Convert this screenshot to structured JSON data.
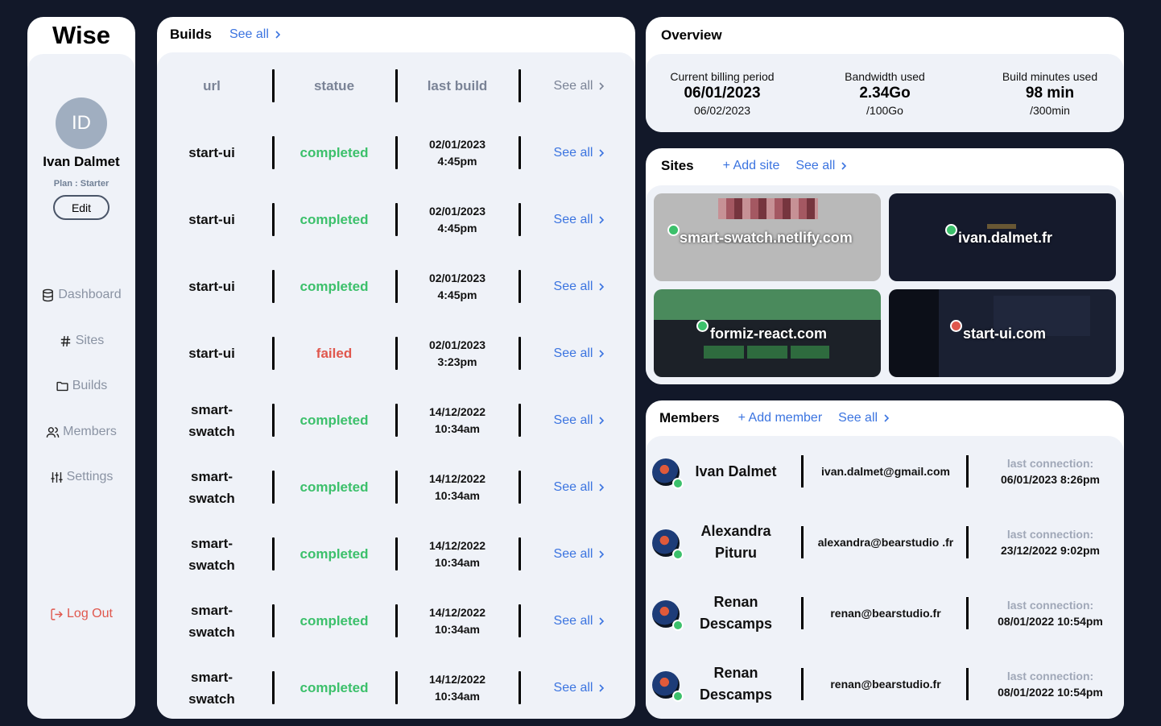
{
  "sidebar": {
    "logo": "Wise",
    "avatar_initials": "ID",
    "user_name": "Ivan Dalmet",
    "plan": "Plan : Starter",
    "edit_label": "Edit",
    "nav": [
      {
        "label": "Dashboard",
        "icon": "database-icon"
      },
      {
        "label": "Sites",
        "icon": "hash-icon"
      },
      {
        "label": "Builds",
        "icon": "folder-icon"
      },
      {
        "label": "Members",
        "icon": "users-icon"
      },
      {
        "label": "Settings",
        "icon": "sliders-icon"
      }
    ],
    "logout_label": "Log Out"
  },
  "builds": {
    "title": "Builds",
    "see_all": "See all",
    "headers": {
      "url": "url",
      "status": "statue",
      "last_build": "last build",
      "see_all": "See all"
    },
    "rows": [
      {
        "url": "start-ui",
        "status": "completed",
        "date": "02/01/2023",
        "time": "4:45pm",
        "see_all": "See all"
      },
      {
        "url": "start-ui",
        "status": "completed",
        "date": "02/01/2023",
        "time": "4:45pm",
        "see_all": "See all"
      },
      {
        "url": "start-ui",
        "status": "completed",
        "date": "02/01/2023",
        "time": "4:45pm",
        "see_all": "See all"
      },
      {
        "url": "start-ui",
        "status": "failed",
        "date": "02/01/2023",
        "time": "3:23pm",
        "see_all": "See all"
      },
      {
        "url": "smart-swatch",
        "status": "completed",
        "date": "14/12/2022",
        "time": "10:34am",
        "see_all": "See all"
      },
      {
        "url": "smart-swatch",
        "status": "completed",
        "date": "14/12/2022",
        "time": "10:34am",
        "see_all": "See all"
      },
      {
        "url": "smart-swatch",
        "status": "completed",
        "date": "14/12/2022",
        "time": "10:34am",
        "see_all": "See all"
      },
      {
        "url": "smart-swatch",
        "status": "completed",
        "date": "14/12/2022",
        "time": "10:34am",
        "see_all": "See all"
      },
      {
        "url": "smart-swatch",
        "status": "completed",
        "date": "14/12/2022",
        "time": "10:34am",
        "see_all": "See all"
      }
    ]
  },
  "overview": {
    "title": "Overview",
    "billing": {
      "label": "Current billing period",
      "value": "06/01/2023",
      "sub": "06/02/2023"
    },
    "bandwidth": {
      "label": "Bandwidth used",
      "value": "2.34Go",
      "sub": "/100Go"
    },
    "build_minutes": {
      "label": "Build minutes used",
      "value": "98 min",
      "sub": "/300min"
    }
  },
  "sites": {
    "title": "Sites",
    "add_label": "+ Add site",
    "see_all": "See all",
    "items": [
      {
        "name": "smart-swatch.netlify.com",
        "status": "online"
      },
      {
        "name": "ivan.dalmet.fr",
        "status": "online"
      },
      {
        "name": "formiz-react.com",
        "status": "online"
      },
      {
        "name": "start-ui.com",
        "status": "offline"
      }
    ]
  },
  "members": {
    "title": "Members",
    "add_label": "+ Add member",
    "see_all": "See all",
    "last_label": "last connection:",
    "items": [
      {
        "name": "Ivan Dalmet",
        "email": "ivan.dalmet@gmail.com",
        "last": "06/01/2023 8:26pm"
      },
      {
        "name": "Alexandra Pituru",
        "email": "alexandra@bearstudio .fr",
        "last": "23/12/2022 9:02pm"
      },
      {
        "name": "Renan Descamps",
        "email": "renan@bearstudio.fr",
        "last": "08/01/2022 10:54pm"
      },
      {
        "name": "Renan Descamps",
        "email": "renan@bearstudio.fr",
        "last": "08/01/2022 10:54pm"
      }
    ]
  },
  "colors": {
    "background": "#121829",
    "link": "#3b74e0",
    "success": "#3cc06b",
    "danger": "#e0574d"
  }
}
